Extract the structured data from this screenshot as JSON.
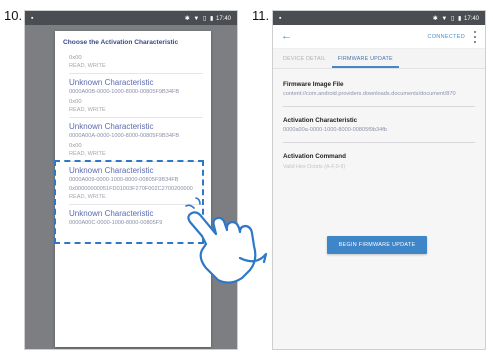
{
  "steps": {
    "step1": "10.",
    "step2": "11."
  },
  "status_bar": {
    "time": "17:40",
    "icons": "✱ ▼ ▯ ▮"
  },
  "phone1": {
    "dialog_title": "Choose the Activation Characteristic",
    "characteristics": [
      {
        "name": "",
        "uuid": "",
        "value": "0x00",
        "props": "READ, WRITE"
      },
      {
        "name": "Unknown Characteristic",
        "uuid": "0000A00B-0000-1000-8000-00805F9B34FB",
        "value": "0x00",
        "props": "READ, WRITE"
      },
      {
        "name": "Unknown Characteristic",
        "uuid": "0000A00A-0000-1000-8000-00805F9B34FB",
        "value": "0x00",
        "props": "READ, WRITE"
      },
      {
        "name": "Unknown Characteristic",
        "uuid": "0000A009-0000-1000-8000-00805F9B34FB",
        "value": "0x00000000051FD01003F270F002C2700200000",
        "props": "READ, WRITE"
      },
      {
        "name": "Unknown Characteristic",
        "uuid": "0000A00C-0000-1000-8000-00805F9",
        "value": "",
        "props": ""
      }
    ]
  },
  "phone2": {
    "connected_label": "CONNECTED",
    "tabs": [
      {
        "label": "DEVICE DETAIL",
        "active": false
      },
      {
        "label": "FIRMWARE UPDATE",
        "active": true
      }
    ],
    "firmware_file": {
      "label": "Firmware Image File",
      "value": "content://com.android.providers.downloads.documents/document/870"
    },
    "activation_characteristic": {
      "label": "Activation Characteristic",
      "value": "0000a00a-0000-1000-8000-00805f9b34fb"
    },
    "activation_command": {
      "label": "Activation Command",
      "hint": "Valid Hex Octets (A-F,0-9)"
    },
    "begin_button": "BEGIN FIRMWARE UPDATE"
  },
  "colors": {
    "accent": "#3f86c8",
    "highlight": "#2e78c7",
    "status_bar": "#4a4d52",
    "dialog_title": "#3a4a8a"
  },
  "icons": {
    "back": "arrow-left-icon",
    "menu": "more-vert-icon",
    "pointer": "hand-pointer-icon"
  }
}
